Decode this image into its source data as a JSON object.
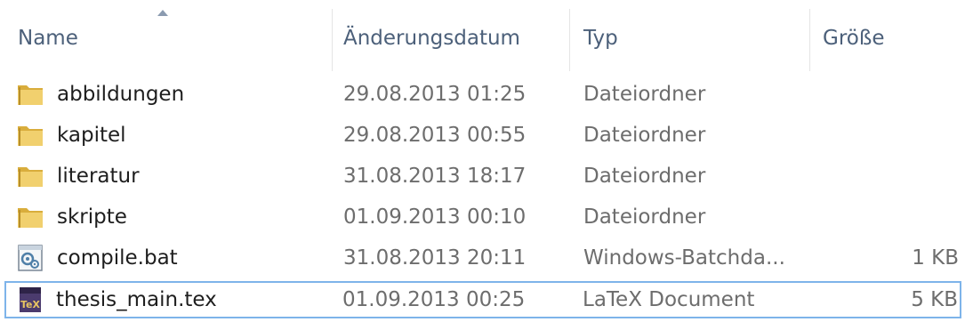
{
  "columns": {
    "name": "Name",
    "modified": "Änderungsdatum",
    "type": "Typ",
    "size": "Größe"
  },
  "colors": {
    "header_text": "#4c607a",
    "row_text": "#1e1e1e",
    "meta_text": "#6d6d6d",
    "selection_border": "#7eb4ea",
    "folder": "#e8c562"
  },
  "files": [
    {
      "name": "abbildungen",
      "modified": "29.08.2013 01:25",
      "type": "Dateiordner",
      "size": "",
      "icon": "folder-icon"
    },
    {
      "name": "kapitel",
      "modified": "29.08.2013 00:55",
      "type": "Dateiordner",
      "size": "",
      "icon": "folder-icon"
    },
    {
      "name": "literatur",
      "modified": "31.08.2013 18:17",
      "type": "Dateiordner",
      "size": "",
      "icon": "folder-icon"
    },
    {
      "name": "skripte",
      "modified": "01.09.2013 00:10",
      "type": "Dateiordner",
      "size": "",
      "icon": "folder-icon"
    },
    {
      "name": "compile.bat",
      "modified": "31.08.2013 20:11",
      "type": "Windows-Batchda...",
      "size": "1 KB",
      "icon": "batch-file-icon"
    },
    {
      "name": "thesis_main.tex",
      "modified": "01.09.2013 00:25",
      "type": "LaTeX Document",
      "size": "5 KB",
      "icon": "tex-file-icon"
    }
  ]
}
